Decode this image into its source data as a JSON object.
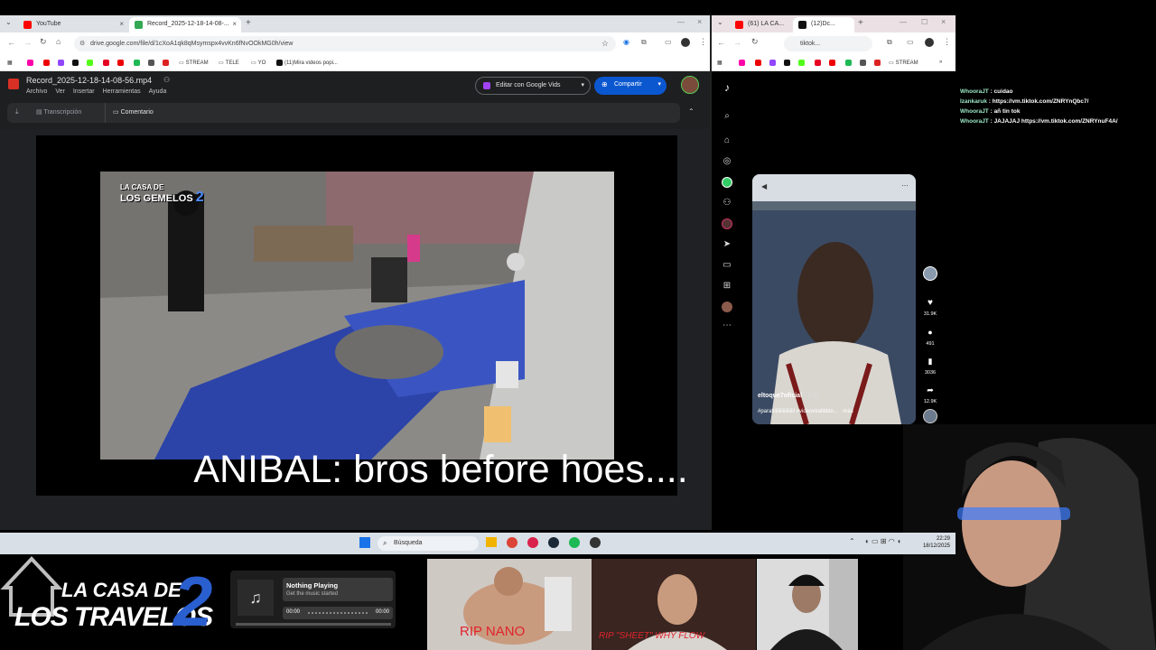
{
  "browser_left": {
    "tabs": [
      {
        "label": "YouTube"
      },
      {
        "label": "Record_2025-12-18-14-08-..."
      }
    ],
    "new_tab": "+",
    "url": "drive.google.com/file/d/1cXoA1qk8qMsymspx4vvKn6fNvOOkMG0h/view",
    "bookmarks": [
      "STREAM",
      "TELE",
      "YO",
      "(11)Mira videos popi..."
    ],
    "drive": {
      "filename": "Record_2025-12-18-14-08-56.mp4",
      "menus": [
        "Archivo",
        "Ver",
        "Insertar",
        "Herramientas",
        "Ayuda"
      ],
      "vids_button": "Editar con Google Vids",
      "share_button": "Compartir",
      "transcription": "Transcripción",
      "comment": "Comentario"
    },
    "video_logo_line1": "LA CASA DE",
    "video_logo_line2": "LOS GEMELOS",
    "video_logo_num": "2"
  },
  "caption": "ANIBAL: bros before hoes....",
  "browser_right": {
    "tabs": [
      {
        "label": "(61) LA CA..."
      },
      {
        "label": "(12)Dc..."
      }
    ],
    "url": "tiktok...",
    "bookmarks": [
      "STREAM"
    ],
    "video": {
      "author": "eltoque7oficial",
      "date": "2-11",
      "hashtags": "#paratiiiiiiiiiiiiiiiiii #videoviralitikto...",
      "more": "más",
      "likes": "31.9K",
      "comments": "491",
      "saves": "3036",
      "shares": "12.9K"
    }
  },
  "chat": [
    {
      "user": "WhooraJT",
      "msg": "cuidao"
    },
    {
      "user": "Izankaruk",
      "msg": "https://vm.tiktok.com/ZNRYnQbc7/"
    },
    {
      "user": "WhooraJT",
      "msg": "añ tin tok"
    },
    {
      "user": "WhooraJT",
      "msg": "JAJAJAJ https://vm.tiktok.com/ZNRYnuF4A/"
    }
  ],
  "taskbar": {
    "search_placeholder": "Búsqueda",
    "time": "22:29",
    "date": "18/12/2025"
  },
  "overlay": {
    "logo_line1": "LA CASA DE",
    "logo_line2": "LOS TRAVELOS",
    "logo_num": "2",
    "music_title": "Nothing Playing",
    "music_sub": "Get the music started",
    "time_start": "00:00",
    "time_end": "00:00",
    "thumb1_caption": "RIP NANO",
    "thumb2_caption": "RIP \"SHEET\" WHY FLOW"
  },
  "colors": {
    "share_blue": "#0b57d0",
    "drive_bg": "#1e1f20",
    "chat_user": "#9be7c4",
    "logo_blue": "#2a5fcf"
  }
}
